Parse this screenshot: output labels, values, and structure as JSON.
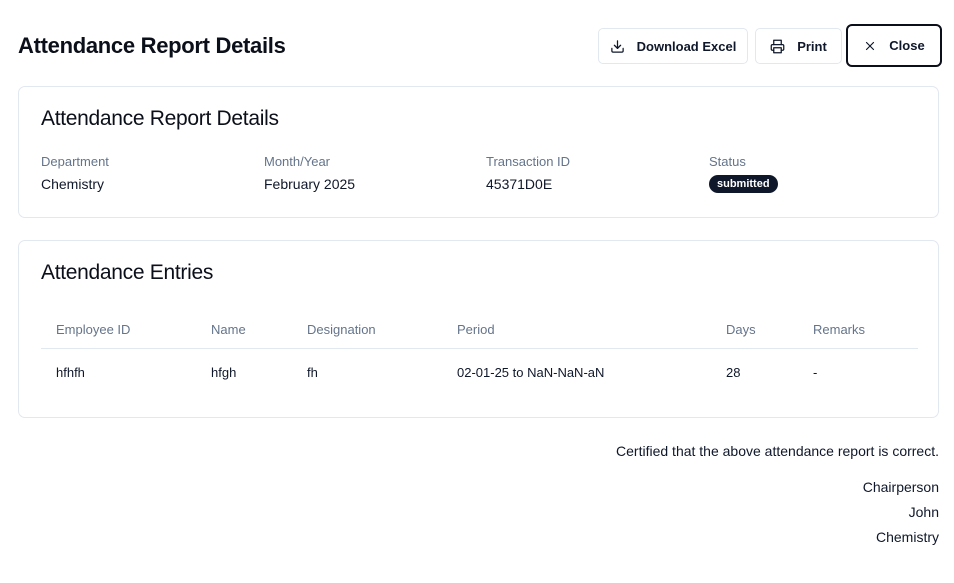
{
  "header": {
    "title": "Attendance Report Details",
    "buttons": {
      "download_excel": "Download Excel",
      "print": "Print",
      "close": "Close"
    }
  },
  "details": {
    "title": "Attendance Report Details",
    "fields": [
      {
        "label": "Department",
        "value": "Chemistry"
      },
      {
        "label": "Month/Year",
        "value": "February 2025"
      },
      {
        "label": "Transaction ID",
        "value": "45371D0E"
      },
      {
        "label": "Status",
        "value": "submitted"
      }
    ]
  },
  "entries": {
    "title": "Attendance Entries",
    "columns": [
      "Employee ID",
      "Name",
      "Designation",
      "Period",
      "Days",
      "Remarks"
    ],
    "rows": [
      [
        "hfhfh",
        "hfgh",
        "fh",
        "02-01-25 to NaN-NaN-aN",
        "28",
        "-"
      ]
    ]
  },
  "footer": {
    "certification": "Certified that the above attendance report is correct.",
    "role": "Chairperson",
    "name": "John",
    "department": "Chemistry"
  },
  "colors": {
    "primary": "#0f172a",
    "muted": "#64748b",
    "border": "#e2e8f0"
  }
}
